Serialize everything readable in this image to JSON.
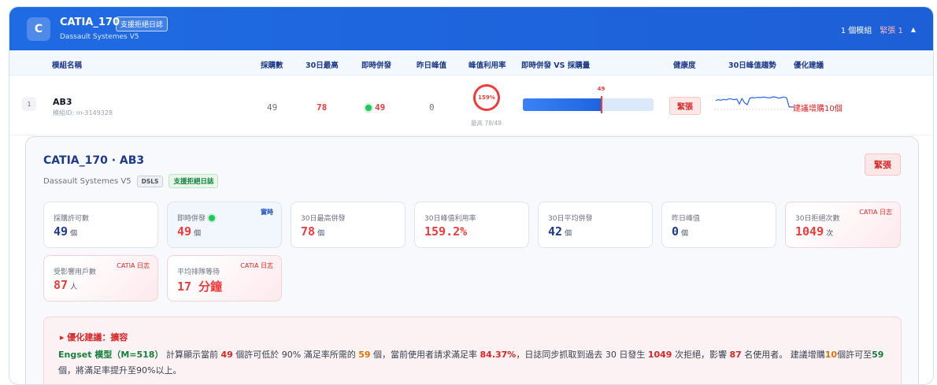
{
  "header": {
    "logo_letter": "C",
    "title": "CATIA_170",
    "badge": "支援拒絕日誌",
    "vendor": "Dassault Systemes V5",
    "module_count": "1 個模組",
    "urgent_count": "緊張 1",
    "collapse_icon": "chevron-up-icon"
  },
  "columns": {
    "name": "模組名稱",
    "purchased": "採購數",
    "peak30": "30日最高",
    "live": "即時併發",
    "yesterday": "昨日峰值",
    "peak_util": "峰值利用率",
    "live_vs_purchase": "即時併發 VS 採購量",
    "health": "健康度",
    "trend": "30日峰值趨勢",
    "advice": "優化建議"
  },
  "row": {
    "index": "1",
    "name": "AB3",
    "module_id": "模組ID: m-3149328",
    "purchased": "49",
    "peak30": "78",
    "live": "49",
    "yesterday": "0",
    "util": "159%",
    "util_sub": "最高 78/49",
    "bar_marker_label": "49",
    "bar_fill_fraction": 0.6,
    "bar_marker_fraction": 0.6,
    "health": "緊張",
    "advice": "建議增購10個",
    "trend_values": [
      52,
      55,
      53,
      56,
      54,
      58,
      57,
      55,
      57,
      40,
      59,
      44,
      38,
      60,
      62,
      61,
      63,
      62,
      64,
      63,
      61,
      62,
      65,
      63,
      60,
      62,
      64,
      61,
      30,
      30,
      30
    ]
  },
  "detail": {
    "title": "CATIA_170 · AB3",
    "vendor": "Dassault Systemes V5",
    "tag_dsls": "DSLS",
    "tag_reject": "支援拒絕日誌",
    "health": "緊張",
    "cards": [
      {
        "label": "採購許可數",
        "value": "49",
        "unit": "個",
        "color": "#1e3a8a"
      },
      {
        "label": "即時併發",
        "value": "49",
        "unit": "個",
        "color": "#ef3b3b",
        "corner": "實時"
      },
      {
        "label": "30日最高併發",
        "value": "78",
        "unit": "個",
        "color": "#ef3b3b"
      },
      {
        "label": "30日峰值利用率",
        "value": "159.2%",
        "unit": "",
        "color": "#ef3b3b"
      },
      {
        "label": "30日平均併發",
        "value": "42",
        "unit": "個",
        "color": "#1e3a8a"
      },
      {
        "label": "昨日峰值",
        "value": "0",
        "unit": "個",
        "color": "#1e3a8a"
      },
      {
        "label": "30日拒絕次數",
        "value": "1049",
        "unit": "次",
        "color": "#ef3b3b",
        "corner": "CATIA 日志"
      },
      {
        "label": "受影響用戶數",
        "value": "87",
        "unit": "人",
        "color": "#ef3b3b",
        "corner": "CATIA 日志"
      },
      {
        "label": "平均排隊等待",
        "value": "17 分鐘",
        "unit": "",
        "color": "#ef3b3b",
        "corner": "CATIA 日志"
      }
    ],
    "advice_title": "▸ 優化建議：擴容",
    "advice": {
      "model": "Engset 模型（M=518）",
      "t1": " 計算顯示當前 ",
      "n1": "49",
      "t2": " 個許可低於 90% 滿足率所需的 ",
      "n2": "59",
      "t3": " 個，當前使用者請求滿足率 ",
      "n3": "84.37%",
      "t4": "，日誌同步抓取到過去 30 日發生 ",
      "n4": "1049",
      "t5": " 次拒絕，影響 ",
      "n5": "87",
      "t6": " 名使用者。 建議增購",
      "n6": "10",
      "t7": "個許可至",
      "n7": "59",
      "t8": "個，將滿足率提升至90%以上。"
    }
  }
}
